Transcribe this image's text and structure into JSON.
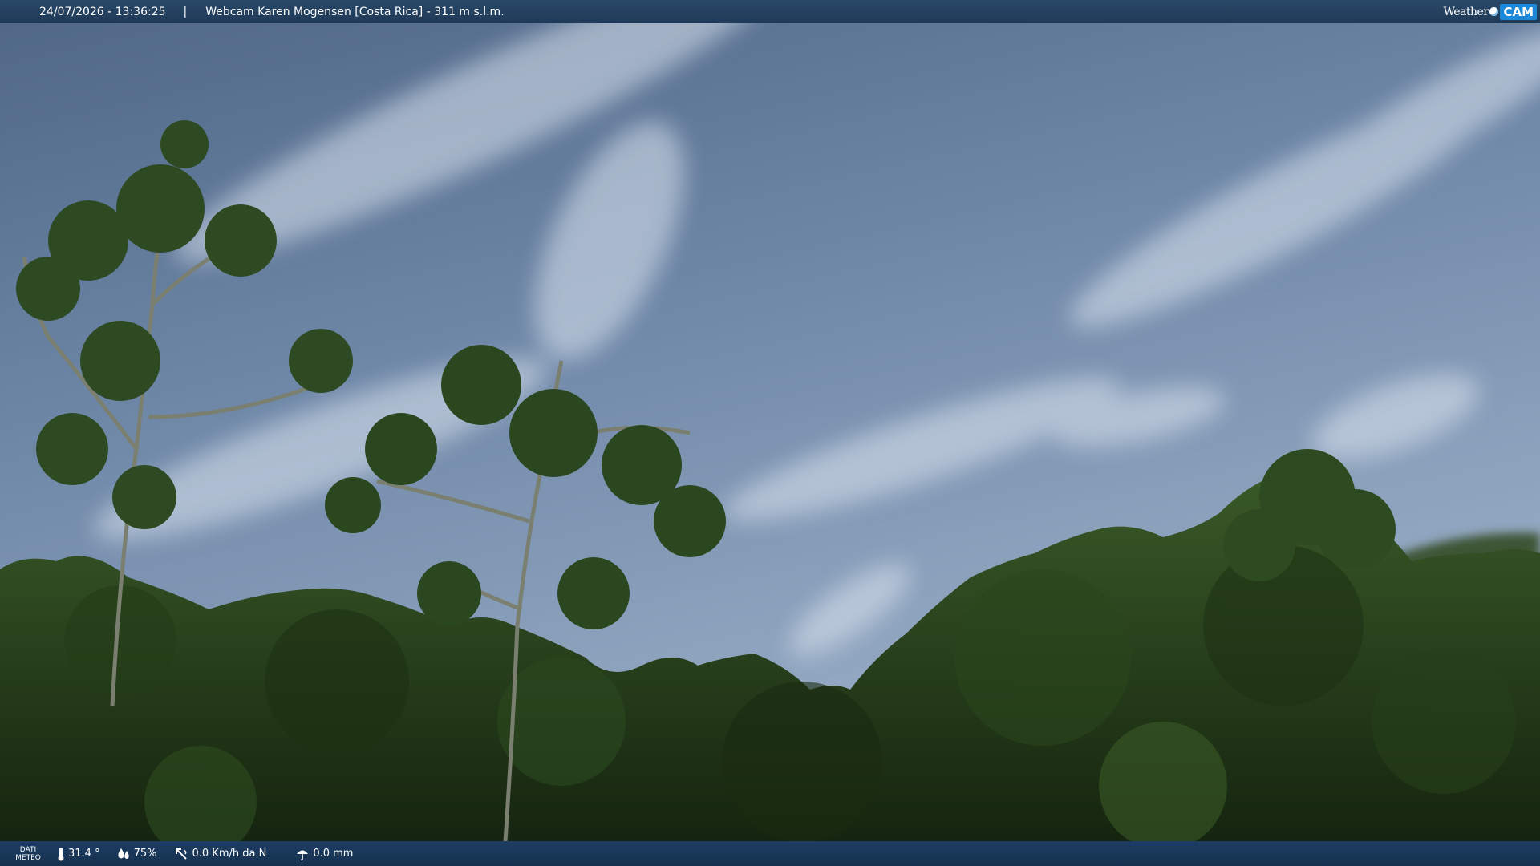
{
  "header": {
    "datetime": "24/07/2026 - 13:36:25",
    "separator": "|",
    "title": "Webcam Karen Mogensen [Costa Rica] - 311 m s.l.m."
  },
  "brand": {
    "part1": "Weather",
    "part2": "CAM"
  },
  "weather_bar": {
    "label": "DATI METEO",
    "temperature": "31.4 °",
    "humidity": "75%",
    "wind": "0.0 Km/h da N",
    "rain": "0.0 mm"
  },
  "colors": {
    "sky_top": "#51698a",
    "sky_bottom": "#90a6c2",
    "foliage_dark": "#16240f",
    "foliage_mid": "#2f4a20",
    "bar": "#1d3d63"
  }
}
